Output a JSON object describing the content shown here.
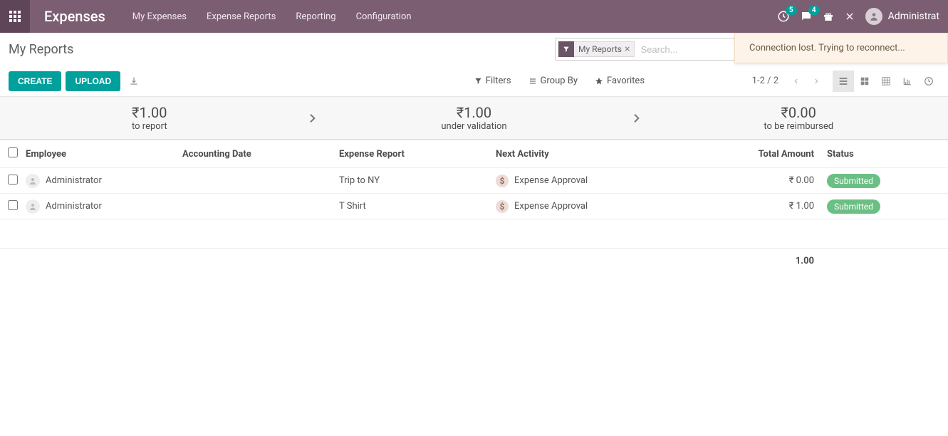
{
  "nav": {
    "brand": "Expenses",
    "links": [
      "My Expenses",
      "Expense Reports",
      "Reporting",
      "Configuration"
    ],
    "badge_clock": "5",
    "badge_chat": "4",
    "user_name": "Administrat"
  },
  "toast": {
    "message": "Connection lost. Trying to reconnect..."
  },
  "breadcrumb": "My Reports",
  "buttons": {
    "create": "CREATE",
    "upload": "UPLOAD"
  },
  "search": {
    "facet_label": "My Reports",
    "placeholder": "Search..."
  },
  "cp_tools": {
    "filters": "Filters",
    "group_by": "Group By",
    "favorites": "Favorites"
  },
  "pager": "1-2 / 2",
  "summary": {
    "to_report_amount": "₹1.00",
    "to_report_label": "to report",
    "under_validation_amount": "₹1.00",
    "under_validation_label": "under validation",
    "to_reimburse_amount": "₹0.00",
    "to_reimburse_label": "to be reimbursed"
  },
  "columns": {
    "employee": "Employee",
    "accounting_date": "Accounting Date",
    "expense_report": "Expense Report",
    "next_activity": "Next Activity",
    "total_amount": "Total Amount",
    "status": "Status"
  },
  "rows": [
    {
      "employee": "Administrator",
      "accounting_date": "",
      "expense_report": "Trip to NY",
      "next_activity": "Expense Approval",
      "total_amount": "₹ 0.00",
      "status": "Submitted"
    },
    {
      "employee": "Administrator",
      "accounting_date": "",
      "expense_report": "T Shirt",
      "next_activity": "Expense Approval",
      "total_amount": "₹ 1.00",
      "status": "Submitted"
    }
  ],
  "footer_total": "1.00"
}
